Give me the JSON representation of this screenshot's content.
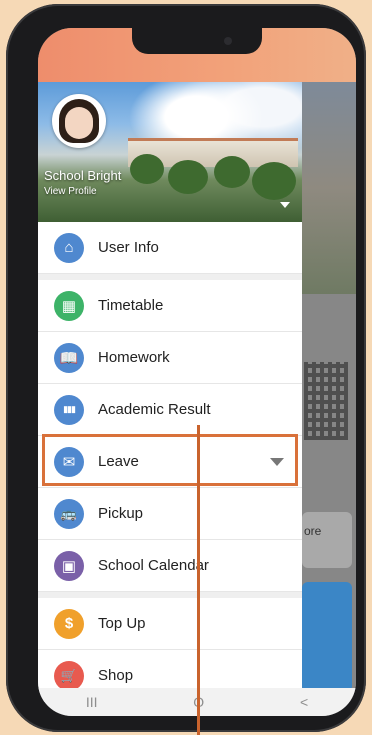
{
  "profile": {
    "name": "School Bright",
    "link": "View Profile"
  },
  "menu": {
    "items": [
      {
        "label": "User Info",
        "icon": "home-icon",
        "color": "#4f88cf",
        "glyph": "⌂"
      },
      {
        "label": "Timetable",
        "icon": "calendar-grid-icon",
        "color": "#3db368",
        "glyph": "▦"
      },
      {
        "label": "Homework",
        "icon": "book-icon",
        "color": "#4f88cf",
        "glyph": "📖"
      },
      {
        "label": "Academic Result",
        "icon": "bar-chart-icon",
        "color": "#4f88cf",
        "glyph": "▮▮▮"
      },
      {
        "label": "Leave",
        "icon": "envelope-icon",
        "color": "#4f88cf",
        "glyph": "✉"
      },
      {
        "label": "Pickup",
        "icon": "bus-icon",
        "color": "#4f88cf",
        "glyph": "🚌"
      },
      {
        "label": "School Calendar",
        "icon": "calendar-icon",
        "color": "#7a60a8",
        "glyph": "▣"
      },
      {
        "label": "Top Up",
        "icon": "dollar-icon",
        "color": "#f0a02b",
        "glyph": "$"
      },
      {
        "label": "Shop",
        "icon": "cart-icon",
        "color": "#e85a4f",
        "glyph": "🛒"
      }
    ]
  },
  "background": {
    "more_label": "ore"
  },
  "navbar": {
    "recent": "III",
    "home": "O",
    "back": "<"
  }
}
